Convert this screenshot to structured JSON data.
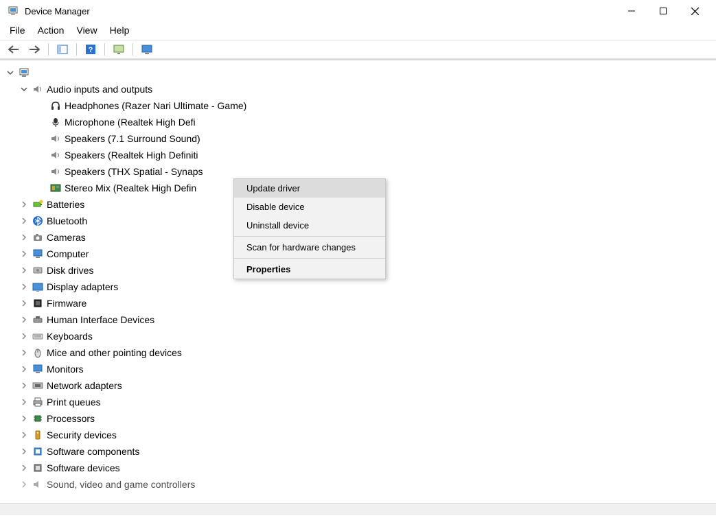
{
  "window": {
    "title": "Device Manager"
  },
  "menu": {
    "file": "File",
    "action": "Action",
    "view": "View",
    "help": "Help"
  },
  "tree": {
    "root": {
      "label": ""
    },
    "audio": {
      "label": "Audio inputs and outputs",
      "children": {
        "headphones": "Headphones (Razer Nari Ultimate - Game)",
        "microphone": "Microphone (Realtek High Defi",
        "speakers71": "Speakers (7.1 Surround Sound)",
        "speakersRealtek": "Speakers (Realtek High Definiti",
        "speakersThx": "Speakers (THX Spatial - Synaps",
        "stereoMix": "Stereo Mix (Realtek High Defin"
      }
    },
    "categories": {
      "batteries": "Batteries",
      "bluetooth": "Bluetooth",
      "cameras": "Cameras",
      "computer": "Computer",
      "diskDrives": "Disk drives",
      "displayAdapters": "Display adapters",
      "firmware": "Firmware",
      "hid": "Human Interface Devices",
      "keyboards": "Keyboards",
      "mice": "Mice and other pointing devices",
      "monitors": "Monitors",
      "networkAdapters": "Network adapters",
      "printQueues": "Print queues",
      "processors": "Processors",
      "securityDevices": "Security devices",
      "softwareComponents": "Software components",
      "softwareDevices": "Software devices",
      "soundControllers": "Sound, video and game controllers"
    }
  },
  "contextMenu": {
    "update": "Update driver",
    "disable": "Disable device",
    "uninstall": "Uninstall device",
    "scan": "Scan for hardware changes",
    "properties": "Properties"
  }
}
